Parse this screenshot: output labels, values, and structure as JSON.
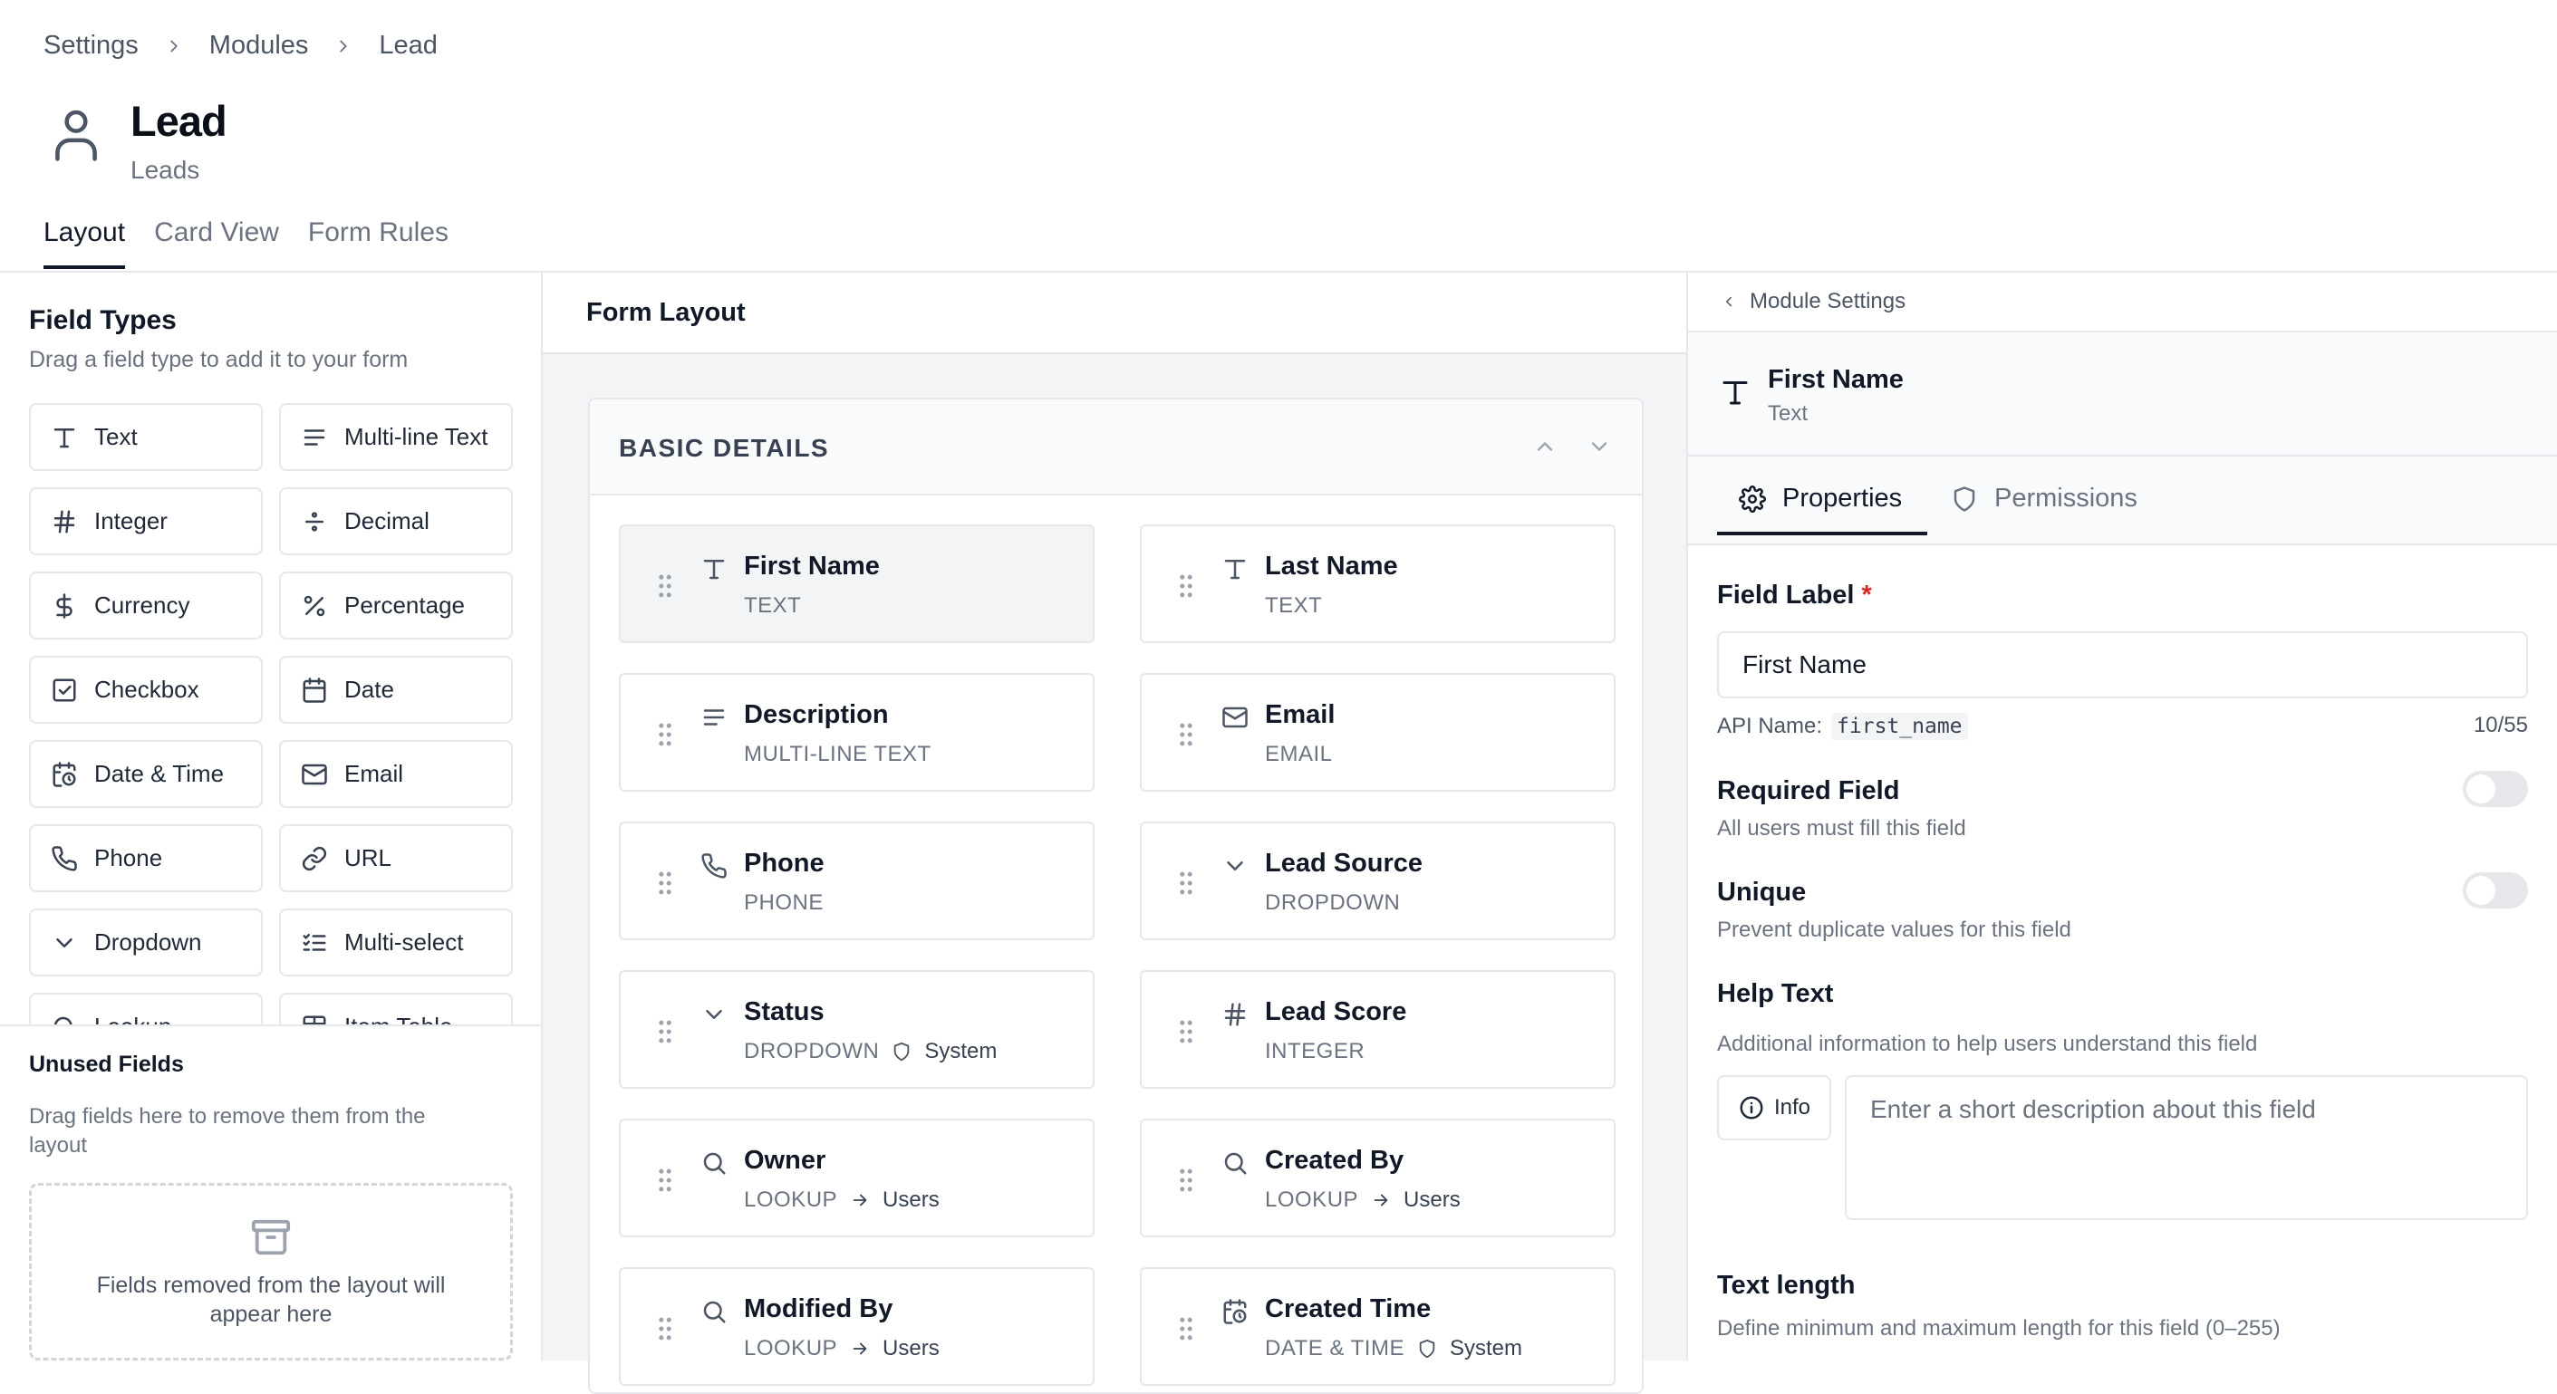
{
  "breadcrumb": [
    "Settings",
    "Modules",
    "Lead"
  ],
  "module": {
    "title": "Lead",
    "subtitle": "Leads"
  },
  "tabs": [
    "Layout",
    "Card View",
    "Form Rules"
  ],
  "field_types": {
    "title": "Field Types",
    "subtitle": "Drag a field type to add it to your form",
    "items": [
      {
        "label": "Text",
        "icon": "text-icon"
      },
      {
        "label": "Multi-line Text",
        "icon": "multiline-icon"
      },
      {
        "label": "Integer",
        "icon": "hash-icon"
      },
      {
        "label": "Decimal",
        "icon": "divide-icon"
      },
      {
        "label": "Currency",
        "icon": "dollar-icon"
      },
      {
        "label": "Percentage",
        "icon": "percent-icon"
      },
      {
        "label": "Checkbox",
        "icon": "checkbox-icon"
      },
      {
        "label": "Date",
        "icon": "calendar-icon"
      },
      {
        "label": "Date & Time",
        "icon": "calendar-clock-icon"
      },
      {
        "label": "Email",
        "icon": "mail-icon"
      },
      {
        "label": "Phone",
        "icon": "phone-icon"
      },
      {
        "label": "URL",
        "icon": "link-icon"
      },
      {
        "label": "Dropdown",
        "icon": "chevron-down-icon"
      },
      {
        "label": "Multi-select",
        "icon": "list-checks-icon"
      },
      {
        "label": "Lookup",
        "icon": "search-icon"
      },
      {
        "label": "Item Table",
        "icon": "table-icon"
      }
    ]
  },
  "unused": {
    "title": "Unused Fields",
    "subtitle": "Drag fields here to remove them from the layout",
    "empty_text": "Fields removed from the layout will appear here"
  },
  "form_layout": {
    "title": "Form Layout",
    "section_label": "BASIC DETAILS",
    "fields": [
      {
        "name": "First Name",
        "type": "TEXT",
        "icon": "text-icon",
        "selected": true
      },
      {
        "name": "Last Name",
        "type": "TEXT",
        "icon": "text-icon"
      },
      {
        "name": "Description",
        "type": "MULTI-LINE TEXT",
        "icon": "multiline-icon"
      },
      {
        "name": "Email",
        "type": "EMAIL",
        "icon": "mail-icon"
      },
      {
        "name": "Phone",
        "type": "PHONE",
        "icon": "phone-icon"
      },
      {
        "name": "Lead Source",
        "type": "DROPDOWN",
        "icon": "chevron-down-icon"
      },
      {
        "name": "Status",
        "type": "DROPDOWN",
        "icon": "chevron-down-icon",
        "system": "System"
      },
      {
        "name": "Lead Score",
        "type": "INTEGER",
        "icon": "hash-icon"
      },
      {
        "name": "Owner",
        "type": "LOOKUP",
        "icon": "search-icon",
        "lookup": "Users"
      },
      {
        "name": "Created By",
        "type": "LOOKUP",
        "icon": "search-icon",
        "lookup": "Users"
      },
      {
        "name": "Modified By",
        "type": "LOOKUP",
        "icon": "search-icon",
        "lookup": "Users"
      },
      {
        "name": "Created Time",
        "type": "DATE & TIME",
        "icon": "calendar-clock-icon",
        "system": "System"
      }
    ]
  },
  "properties": {
    "back_label": "Module Settings",
    "field_name": "First Name",
    "field_type": "Text",
    "tabs": [
      "Properties",
      "Permissions"
    ],
    "field_label": {
      "label": "Field Label",
      "required_mark": "*",
      "value": "First Name"
    },
    "api_name_label": "API Name:",
    "api_name": "first_name",
    "char_count": "10/55",
    "required": {
      "label": "Required Field",
      "hint": "All users must fill this field",
      "on": false
    },
    "unique": {
      "label": "Unique",
      "hint": "Prevent duplicate values for this field",
      "on": false
    },
    "help_text": {
      "label": "Help Text",
      "hint": "Additional information to help users understand this field",
      "type_button": "Info",
      "placeholder": "Enter a short description about this field"
    },
    "text_length": {
      "label": "Text length",
      "hint": "Define minimum and maximum length for this field (0–255)"
    }
  }
}
